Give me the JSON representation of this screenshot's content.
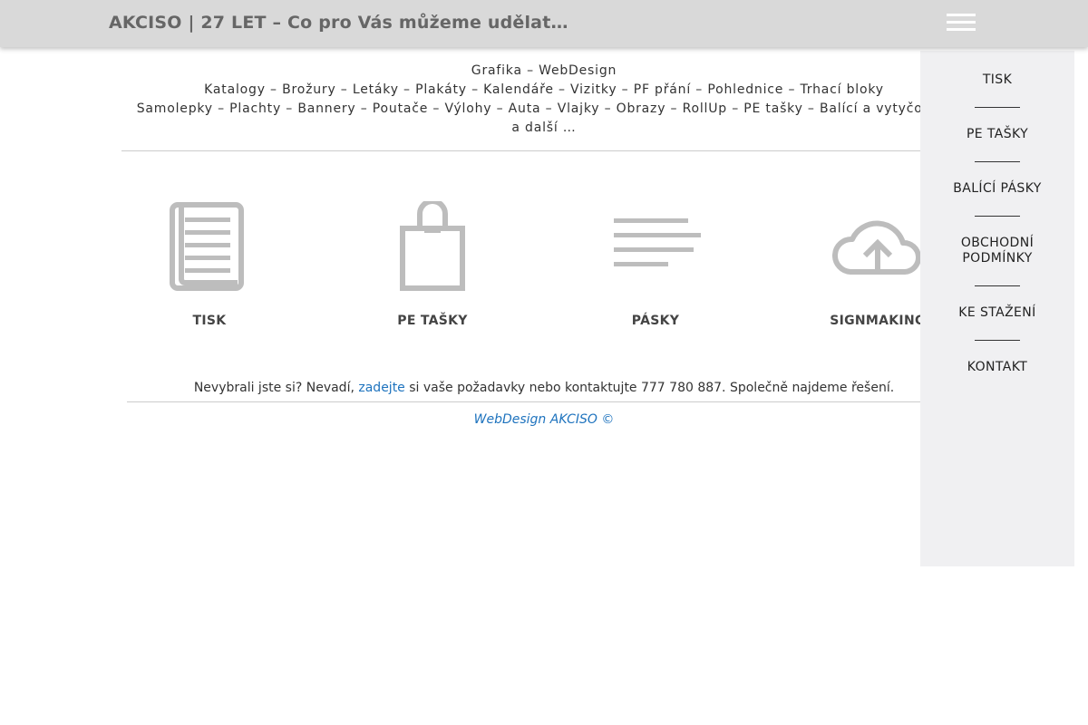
{
  "header": {
    "title": "AKCISO | 27 LET – Co pro Vás můžeme udělat…",
    "menu_icon": "hamburger-icon"
  },
  "intro": {
    "line1": "Grafika – WebDesign",
    "line2": "Katalogy – Brožury – Letáky – Plakáty – Kalendáře – Vizitky – PF přání – Pohlednice – Trhací bloky",
    "line3": "Samolepky – Plachty – Bannery – Poutače – Výlohy – Auta – Vlajky – Obrazy – RollUp – PE tašky – Balící a vytyčovací",
    "line4": "a další …"
  },
  "features": [
    {
      "label": "TISK",
      "icon": "document-icon"
    },
    {
      "label": "PE TAŠKY",
      "icon": "shopping-bag-icon"
    },
    {
      "label": "PÁSKY",
      "icon": "text-lines-icon"
    },
    {
      "label": "SIGNMAKING",
      "icon": "cloud-upload-icon"
    }
  ],
  "contact": {
    "before": "Nevybrali jste si? Nevadí,",
    "link": "zadejte",
    "after": "si vaše požadavky nebo kontaktujte 777 780 887. Společně najdeme řešení."
  },
  "footer": {
    "text": "WebDesign AKCISO ©"
  },
  "menu": {
    "items": [
      "TISK",
      "PE TAŠKY",
      "BALÍCÍ PÁSKY",
      "OBCHODNÍ PODMÍNKY",
      "KE STAŽENÍ",
      "KONTAKT"
    ]
  },
  "colors": {
    "header_bg": "#d9d9d9",
    "icon_gray": "#bdbdbd",
    "link": "#1e73be",
    "menu_bg": "#f0f0f2"
  }
}
